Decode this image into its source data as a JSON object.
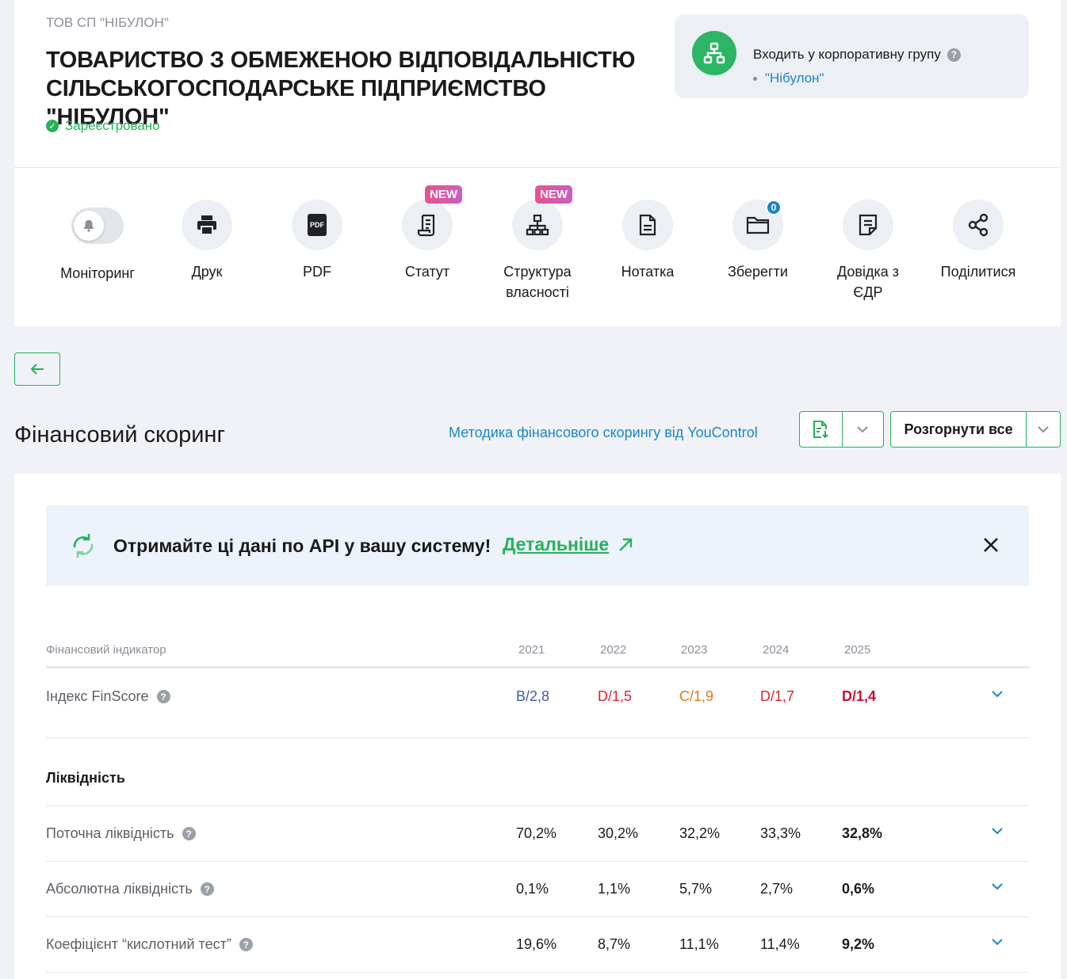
{
  "company": {
    "short_name": "ТОВ СП \"НІБУЛОН\"",
    "full_name": "ТОВАРИСТВО З ОБМЕЖЕНОЮ ВІДПОВІДАЛЬНІСТЮ СІЛЬСЬКОГОСПОДАРСЬКЕ ПІДПРИЄМСТВО \"НІБУЛОН\"",
    "status": "Зареєстровано",
    "status_color": "#27b15b"
  },
  "group": {
    "title": "Входить у корпоративну групу",
    "help": "?",
    "item": "\"Нібулон\""
  },
  "actions": [
    {
      "label": "Моніторинг",
      "icon": "bell-icon"
    },
    {
      "label": "Друк",
      "icon": "printer-icon"
    },
    {
      "label": "PDF",
      "icon": "pdf-icon",
      "icon_text": "PDF"
    },
    {
      "label": "Статут",
      "icon": "scroll-icon",
      "badge": "NEW"
    },
    {
      "label": "Структура власності",
      "icon": "hierarchy-icon",
      "badge": "NEW"
    },
    {
      "label": "Нотатка",
      "icon": "note-icon"
    },
    {
      "label": "Зберегти",
      "icon": "folder-icon",
      "count": "0"
    },
    {
      "label": "Довідка з ЄДР",
      "icon": "document-icon"
    },
    {
      "label": "Поділитися",
      "icon": "share-icon"
    }
  ],
  "section": {
    "title": "Фінансовий скоринг",
    "method_link": "Методика фінансового скорингу від YouControl",
    "expand_label": "Розгорнути все"
  },
  "api_banner": {
    "text": "Отримайте ці дані по API у вашу систему!",
    "link": "Детальніше"
  },
  "table": {
    "header": {
      "indicator": "Фінансовий індикатор",
      "years": [
        "2021",
        "2022",
        "2023",
        "2024",
        "2025"
      ]
    },
    "finscore": {
      "label": "Індекс FinScore",
      "values": [
        "B/2,8",
        "D/1,5",
        "C/1,9",
        "D/1,7",
        "D/1,4"
      ],
      "colors": [
        "#3a5fa8",
        "#d3262e",
        "#d67a1c",
        "#d3262e",
        "#c8102e"
      ]
    },
    "section_label": "Ліквідність",
    "rows": [
      {
        "label": "Поточна ліквідність",
        "values": [
          "70,2%",
          "30,2%",
          "32,2%",
          "33,3%",
          "32,8%"
        ]
      },
      {
        "label": "Абсолютна ліквідність",
        "values": [
          "0,1%",
          "1,1%",
          "5,7%",
          "2,7%",
          "0,6%"
        ]
      },
      {
        "label": "Коефіцієнт “кислотний тест”",
        "values": [
          "19,6%",
          "8,7%",
          "11,1%",
          "11,4%",
          "9,2%"
        ]
      }
    ]
  },
  "colors": {
    "accent": "#27b15b",
    "link": "#1a86c8"
  }
}
